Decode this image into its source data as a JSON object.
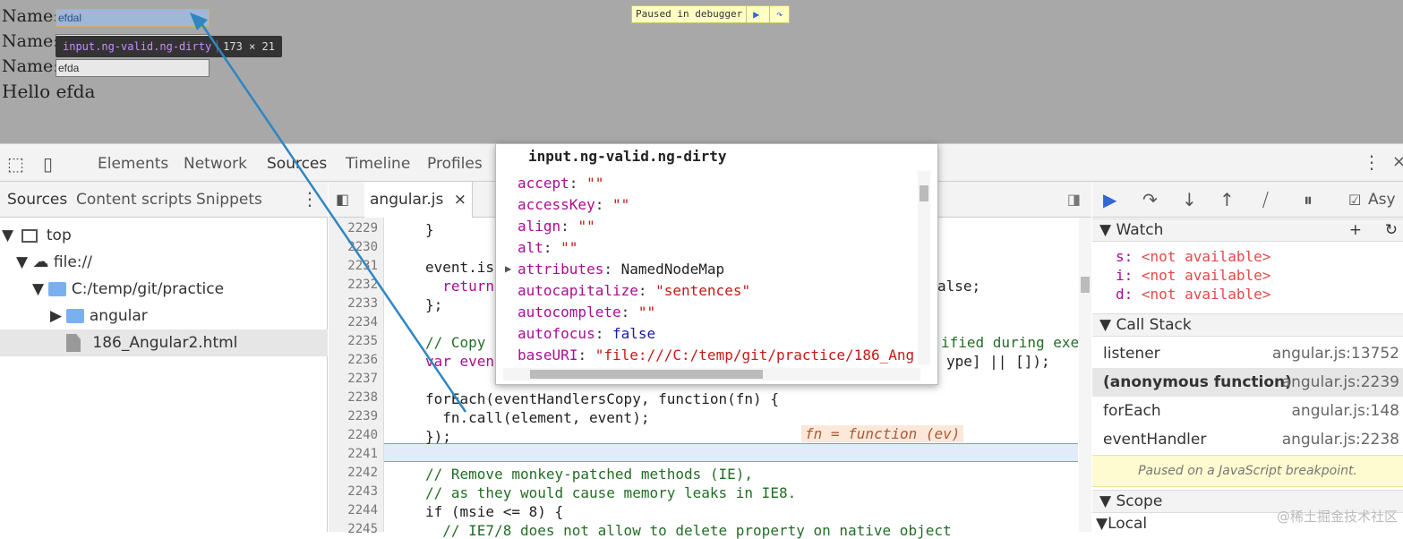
{
  "page": {
    "name_label": "Name:",
    "input1_value": "efdal",
    "input3_value": "efda",
    "hello_text": "Hello efda",
    "tooltip_selector": "input.ng-valid.ng-dirty",
    "tooltip_size": "173 × 21",
    "paused_text": "Paused in debugger"
  },
  "devtools": {
    "tabs": [
      "Elements",
      "Network",
      "Sources",
      "Timeline",
      "Profiles"
    ],
    "left_tabs": [
      "Sources",
      "Content scripts",
      "Snippets"
    ],
    "tree": [
      "top",
      "file://",
      "C:/temp/git/practice",
      "angular",
      "186_Angular2.html"
    ],
    "editor_tab": "angular.js",
    "line_numbers": [
      "2229",
      "2230",
      "2231",
      "2232",
      "2233",
      "2234",
      "2235",
      "2236",
      "2237",
      "2238",
      "2239",
      "2240",
      "2241",
      "2242",
      "2243",
      "2244",
      "2245"
    ],
    "code": {
      "l2229": "}",
      "l2231": "event.is",
      "l2232": "  return",
      "l2232b": "alse;",
      "l2233": "};",
      "l2235": "// Copy",
      "l2235b": "ified during exe",
      "l2236": "var even",
      "l2236b": "ype] || []);",
      "l2238": "forEach(eventHandlersCopy, function(fn) {",
      "l2238_inline": "fn = function (ev)",
      "l2239": "  fn.call(element, event);",
      "l2240": "});",
      "l2242": "// Remove monkey-patched methods (IE),",
      "l2243": "// as they would cause memory leaks in IE8.",
      "l2244": "if (msie <= 8) {",
      "l2245": "  // IE7/8 does not allow to delete property on native object"
    },
    "debugger": {
      "async_label": "Asy",
      "watch_title": "Watch",
      "watch": [
        {
          "key": "s:",
          "value": "<not available>"
        },
        {
          "key": "i:",
          "value": "<not available>"
        },
        {
          "key": "d:",
          "value": "<not available>"
        }
      ],
      "callstack_title": "Call Stack",
      "callstack": [
        {
          "fn": "listener",
          "loc": "angular.js:13752"
        },
        {
          "fn": "(anonymous function)",
          "loc": "angular.js:2239"
        },
        {
          "fn": "forEach",
          "loc": "angular.js:148"
        },
        {
          "fn": "eventHandler",
          "loc": "angular.js:2238"
        }
      ],
      "paused_msg": "Paused on a JavaScript breakpoint.",
      "scope_title": "Scope",
      "local_title": "Local"
    },
    "popover": {
      "title": "input.ng-valid.ng-dirty",
      "props": [
        {
          "k": "accept",
          "v": "\"\"",
          "t": "s"
        },
        {
          "k": "accessKey",
          "v": "\"\"",
          "t": "s"
        },
        {
          "k": "align",
          "v": "\"\"",
          "t": "s"
        },
        {
          "k": "alt",
          "v": "\"\"",
          "t": "s"
        },
        {
          "k": "attributes",
          "v": "NamedNodeMap",
          "t": "o"
        },
        {
          "k": "autocapitalize",
          "v": "\"sentences\"",
          "t": "s"
        },
        {
          "k": "autocomplete",
          "v": "\"\"",
          "t": "s"
        },
        {
          "k": "autofocus",
          "v": "false",
          "t": "b"
        },
        {
          "k": "baseURI",
          "v": "\"file:///C:/temp/git/practice/186_Ang",
          "t": "s"
        }
      ]
    },
    "watermark": "@稀土掘金技术社区"
  }
}
